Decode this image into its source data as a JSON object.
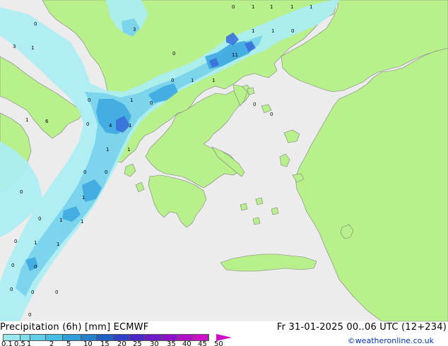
{
  "header": {
    "title": "Precipitation (6h) [mm] ECMWF",
    "valid_time": "Fr 31-01-2025 00..06 UTC (12+234)",
    "copyright": "©weatheronline.co.uk"
  },
  "legend": {
    "labels": [
      "0.1",
      "0.5",
      "1",
      "2",
      "5",
      "10",
      "15",
      "20",
      "25",
      "30",
      "35",
      "40",
      "45",
      "50"
    ],
    "colors": [
      "#9ce8f0",
      "#7fdcec",
      "#5fd0e8",
      "#45bfe4",
      "#309fd8",
      "#2880cc",
      "#2060c4",
      "#3040c8",
      "#4a28c8",
      "#6c1cc8",
      "#8c10c8",
      "#b010c8",
      "#d010c8"
    ]
  },
  "colors": {
    "sea": "#ececec",
    "land": "#b8f08c",
    "precip_light": "#aaeef4",
    "precip_mid": "#78d2ec",
    "precip_heavy": "#3ea8e0",
    "precip_intense": "#3a70d8"
  },
  "map": {
    "values": [
      "0",
      "1",
      "1",
      "1",
      "1",
      "3",
      "0",
      "1",
      "1",
      "0",
      "11",
      "0",
      "1",
      "1",
      "0",
      "0",
      "0",
      "3",
      "1",
      "1",
      "0",
      "1",
      "6",
      "4",
      "1",
      "0",
      "0",
      "1",
      "1",
      "0",
      "0",
      "1",
      "0",
      "1",
      "1",
      "0",
      "1",
      "1",
      "0",
      "0",
      "0",
      "0",
      "0",
      "0",
      "0"
    ]
  }
}
